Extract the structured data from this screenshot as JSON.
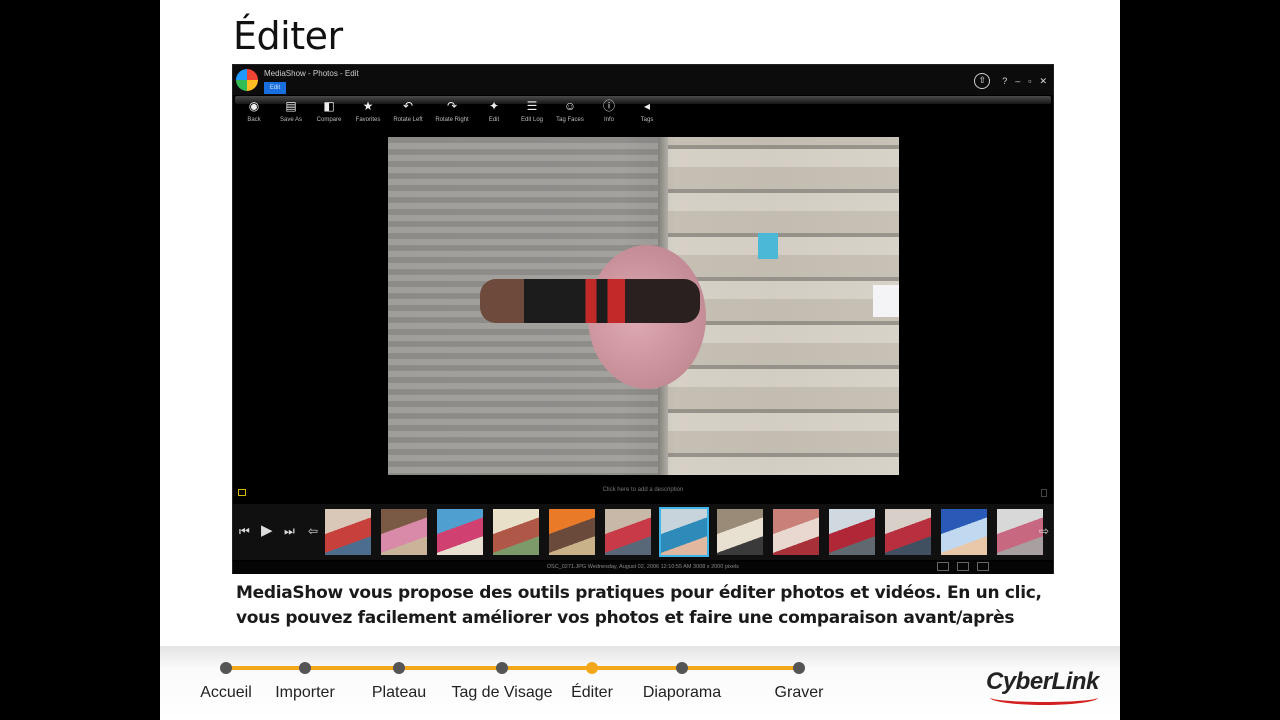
{
  "slide": {
    "title": "Éditer"
  },
  "app": {
    "window_title": "MediaShow - Photos - Edit",
    "tab": "Edit",
    "window_controls": [
      "?",
      "–",
      "▫",
      "✕"
    ],
    "toolbar": [
      {
        "label": "Back",
        "icon": "back-icon",
        "glyph": "◉"
      },
      {
        "label": "Save As",
        "icon": "save-as-icon",
        "glyph": "▤"
      },
      {
        "label": "Compare",
        "icon": "compare-icon",
        "glyph": "◧"
      },
      {
        "label": "Favorites",
        "icon": "star-icon",
        "glyph": "★"
      },
      {
        "label": "Rotate Left",
        "icon": "rotate-left-icon",
        "glyph": "↶"
      },
      {
        "label": "Rotate Right",
        "icon": "rotate-right-icon",
        "glyph": "↷"
      },
      {
        "label": "Edit",
        "icon": "magic-wand-icon",
        "glyph": "✦"
      },
      {
        "label": "Edit Log",
        "icon": "edit-log-icon",
        "glyph": "☰"
      },
      {
        "label": "Tag Faces",
        "icon": "tag-faces-icon",
        "glyph": "☺"
      },
      {
        "label": "Info",
        "icon": "info-icon",
        "glyph": "ⓘ"
      },
      {
        "label": "Tags",
        "icon": "tag-icon",
        "glyph": "◂"
      }
    ],
    "description_prompt": "Click here to add a description",
    "status": "DSC_0271.JPG  Wednesday, August 02, 2006 12:10:55 AM  3008 x 2000 pixels",
    "thumbnail_count": 13,
    "selected_thumbnail": 6
  },
  "caption": {
    "line1": "MediaShow vous propose des outils pratiques pour éditer photos et vidéos. En un clic,",
    "line2": "vous pouvez facilement améliorer vos photos et faire une comparaison avant/après"
  },
  "steps": [
    {
      "label": "Accueil",
      "active": false
    },
    {
      "label": "Importer",
      "active": false
    },
    {
      "label": "Plateau",
      "active": false
    },
    {
      "label": "Tag de Visage",
      "active": false
    },
    {
      "label": "Éditer",
      "active": true
    },
    {
      "label": "Diaporama",
      "active": false
    },
    {
      "label": "Graver",
      "active": false
    }
  ],
  "brand": {
    "name": "CyberLink",
    "accent_color": "#d21f1f",
    "progress_color": "#f2a81a"
  }
}
